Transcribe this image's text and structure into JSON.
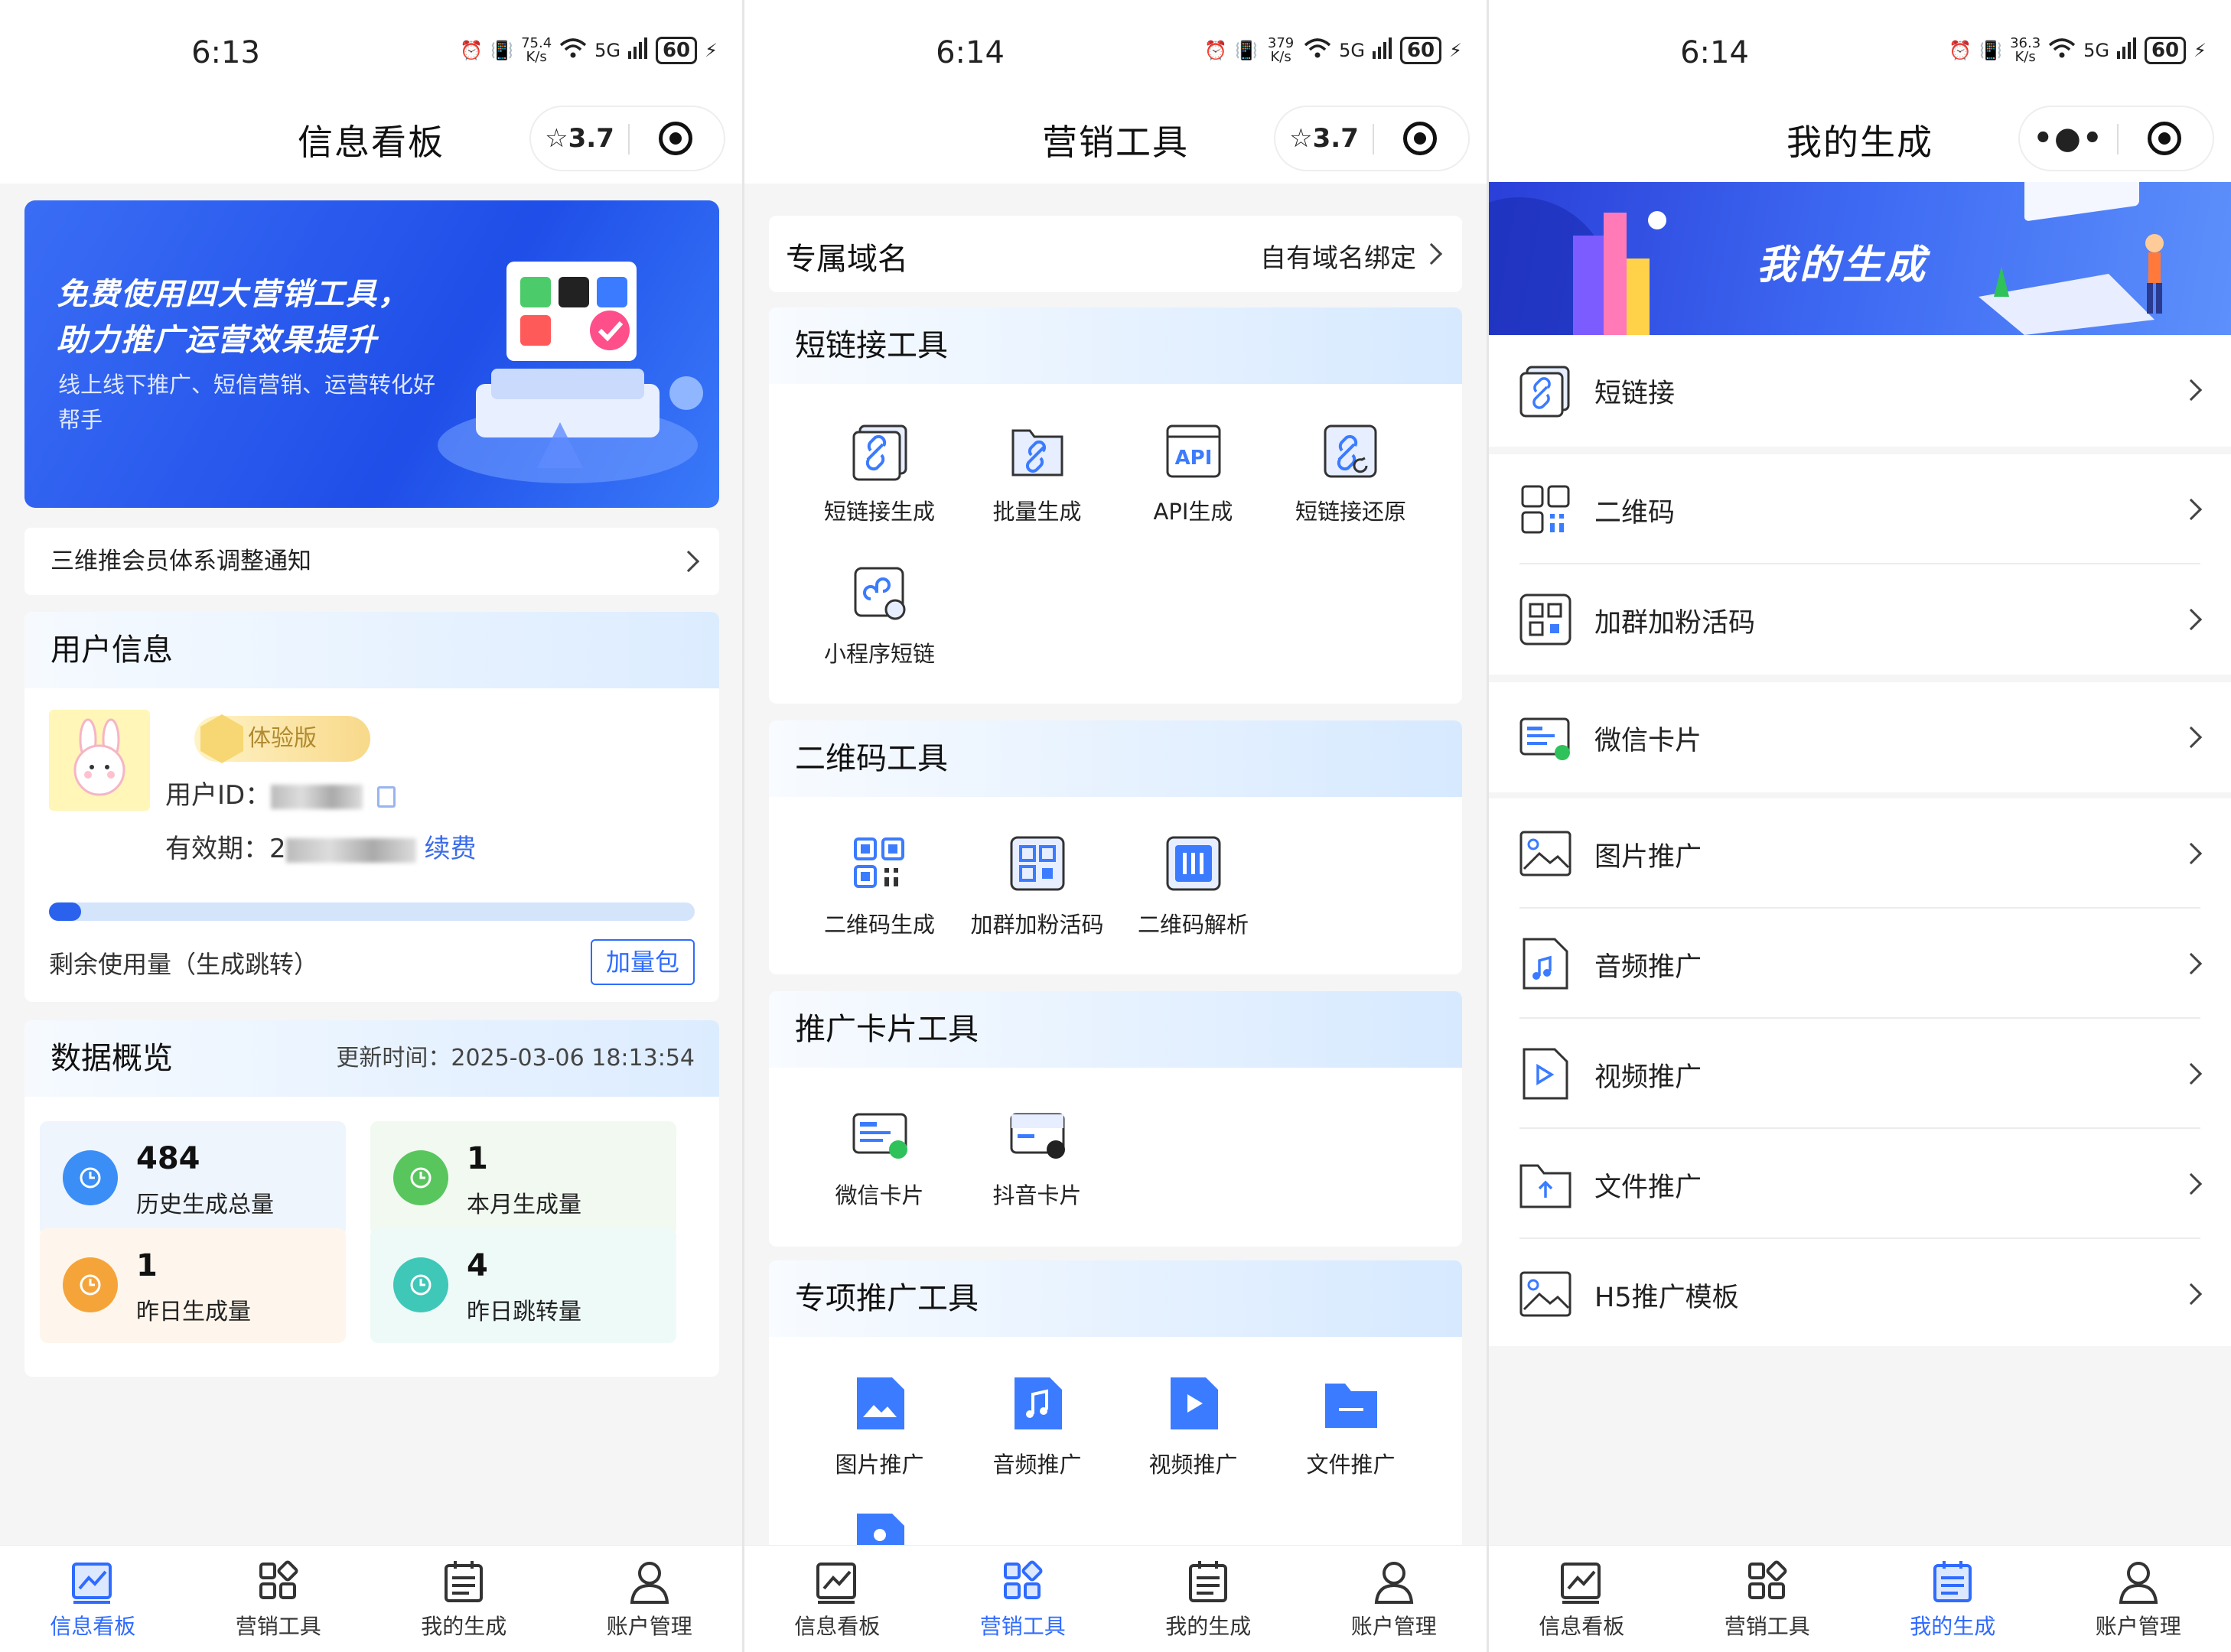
{
  "colors": {
    "accent": "#2f6bff",
    "tab_inactive": "#333333"
  },
  "screens": {
    "s1": {
      "status": {
        "time": "6:13",
        "speed_top": "75.4",
        "speed_unit": "K/s",
        "signal": "5G",
        "battery": "60"
      },
      "title": "信息看板",
      "rating": "3.7",
      "banner": {
        "line1": "免费使用四大营销工具，",
        "line2": "助力推广运营效果提升",
        "line3": "线上线下推广、短信营销、运营转化好帮手"
      },
      "notice": "三维推会员体系调整通知",
      "user": {
        "title": "用户信息",
        "badge": "体验版",
        "id_label": "用户ID：",
        "expire_label": "有效期：",
        "expire_prefix": "2",
        "renew": "续费",
        "remain_label": "剩余使用量（生成跳转）",
        "remain_fraction": 0.05,
        "add_button": "加量包"
      },
      "overview": {
        "title": "数据概览",
        "update": "更新时间：2025-03-06 18:13:54",
        "stats": [
          {
            "num": "484",
            "label": "历史生成总量",
            "color": "#3a8ef6",
            "bg": "#eef5fd",
            "icon": "history-icon"
          },
          {
            "num": "1",
            "label": "本月生成量",
            "color": "#58c65d",
            "bg": "#f1f9f1",
            "icon": "clock-icon"
          },
          {
            "num": "1",
            "label": "昨日生成量",
            "color": "#f5a43a",
            "bg": "#fef6ec",
            "icon": "bar-chart-icon"
          },
          {
            "num": "4",
            "label": "昨日跳转量",
            "color": "#3fc7b8",
            "bg": "#eefaf8",
            "icon": "trend-icon"
          }
        ]
      }
    },
    "s2": {
      "status": {
        "time": "6:14",
        "speed_top": "379",
        "speed_unit": "K/s",
        "signal": "5G",
        "battery": "60"
      },
      "title": "营销工具",
      "rating": "3.7",
      "domain": {
        "title": "专属域名",
        "action": "自有域名绑定"
      },
      "sections": [
        {
          "title": "短链接工具",
          "tools": [
            "短链接生成",
            "批量生成",
            "API生成",
            "短链接还原",
            "小程序短链"
          ]
        },
        {
          "title": "二维码工具",
          "tools": [
            "二维码生成",
            "加群加粉活码",
            "二维码解析"
          ]
        },
        {
          "title": "推广卡片工具",
          "tools": [
            "微信卡片",
            "抖音卡片"
          ]
        },
        {
          "title": "专项推广工具",
          "tools": [
            "图片推广",
            "音频推广",
            "视频推广",
            "文件推广"
          ]
        }
      ],
      "api_text": "API"
    },
    "s3": {
      "status": {
        "time": "6:14",
        "speed_top": "36.3",
        "speed_unit": "K/s",
        "signal": "5G",
        "battery": "60"
      },
      "title": "我的生成",
      "hero": "我的生成",
      "items": [
        "短链接",
        "二维码",
        "加群加粉活码",
        "微信卡片",
        "图片推广",
        "音频推广",
        "视频推广",
        "文件推广",
        "H5推广模板"
      ]
    }
  },
  "tabs": [
    "信息看板",
    "营销工具",
    "我的生成",
    "账户管理"
  ]
}
